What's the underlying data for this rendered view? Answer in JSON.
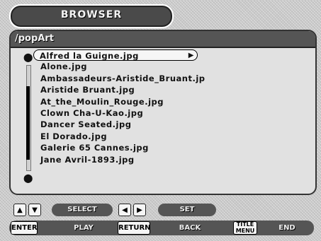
{
  "header": {
    "title": "BROWSER"
  },
  "path": "/popArt",
  "files": [
    "Alfred la Guigne.jpg",
    "Alone.jpg",
    "Ambassadeurs-Aristide_Bruant.jp",
    "Aristide Bruant.jpg",
    "At_the_Moulin_Rouge.jpg",
    "Clown Cha-U-Kao.jpg",
    "Dancer Seated.jpg",
    "El Dorado.jpg",
    "Galerie 65 Cannes.jpg",
    "Jane Avril-1893.jpg"
  ],
  "selected_index": 0,
  "icons": {
    "scroll_up": "up-circle-icon",
    "scroll_down": "down-circle-icon",
    "select_arrow": "play-icon"
  },
  "controls": {
    "up_glyph": "▲",
    "down_glyph": "▼",
    "select_label": "SELECT",
    "left_glyph": "◀",
    "right_glyph": "▶",
    "set_label": "SET",
    "enter_label": "ENTER",
    "play_label": "PLAY",
    "return_label": "RETURN",
    "back_label": "BACK",
    "title_menu_line1": "TITLE",
    "title_menu_line2": "MENU",
    "end_label": "END"
  }
}
